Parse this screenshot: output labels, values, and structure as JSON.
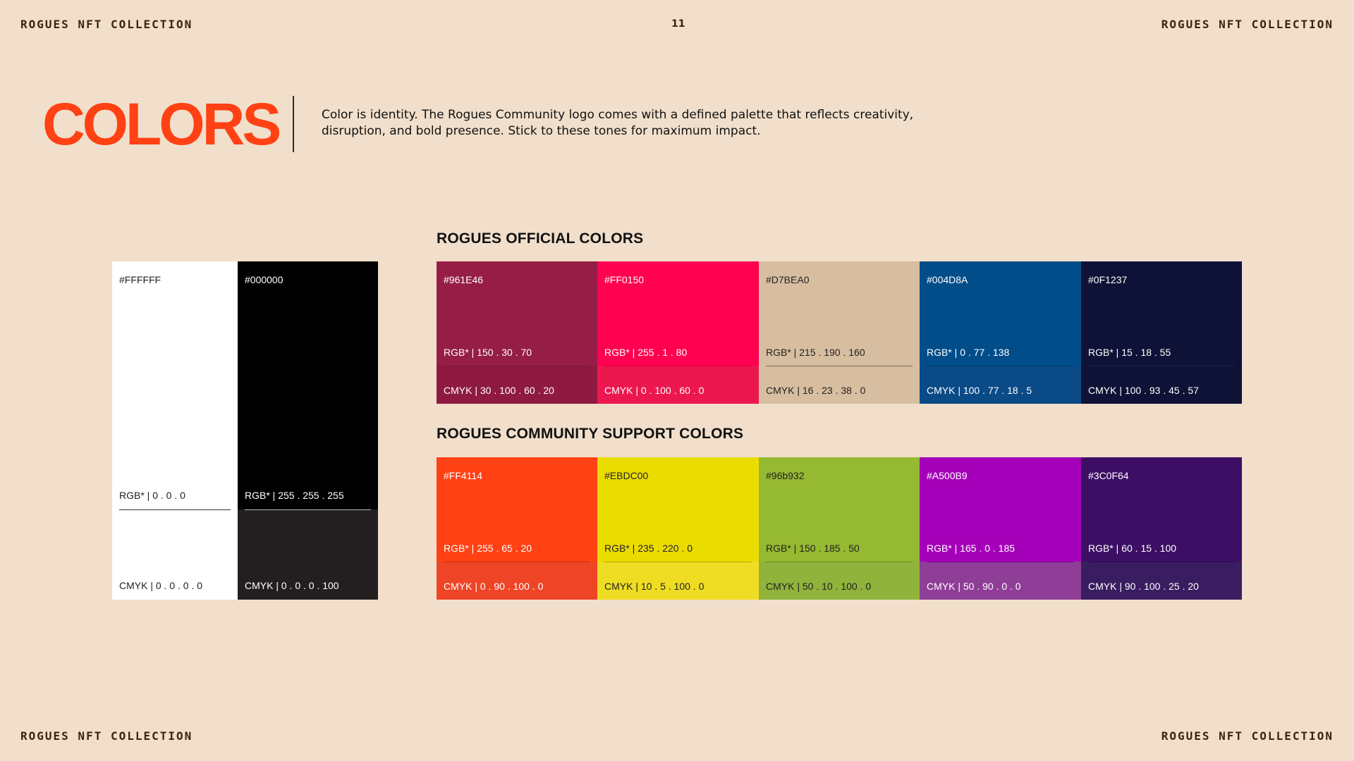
{
  "header": {
    "brand_left": "ROGUES NFT COLLECTION",
    "brand_right": "ROGUES NFT COLLECTION",
    "page_number": "11"
  },
  "footer": {
    "brand_left": "ROGUES NFT COLLECTION",
    "brand_right": "ROGUES NFT COLLECTION"
  },
  "title": "COLORS",
  "intro": "Color is identity. The Rogues Community logo comes with a defined palette that reflects creativity, disruption, and bold presence. Stick to these tones for maximum impact.",
  "base_colors": [
    {
      "hex": "#FFFFFF",
      "rgb": "RGB* | 0 . 0 . 0",
      "cmyk": "CMYK | 0 . 0 . 0 . 0",
      "color": "#FFFFFF",
      "lower_color": "#FFFFFF",
      "text_color": "#222222",
      "rule_color": "#333333"
    },
    {
      "hex": "#000000",
      "rgb": "RGB* | 255 . 255 . 255",
      "cmyk": "CMYK | 0 . 0 . 0 . 100",
      "color": "#000000",
      "lower_color": "#231F20",
      "text_color": "#FFFFFF",
      "rule_color": "#BBBBBB"
    }
  ],
  "official": {
    "heading": "ROGUES OFFICIAL COLORS",
    "colors": [
      {
        "hex": "#961E46",
        "rgb": "RGB* | 150 . 30 . 70",
        "cmyk": "CMYK | 30 . 100 . 60 . 20",
        "color": "#961E46",
        "lower_color": "#8E1A41",
        "text_color": "#FFFFFF",
        "rule_color": "#7A1538"
      },
      {
        "hex": "#FF0150",
        "rgb": "RGB* | 255 . 1 . 80",
        "cmyk": "CMYK | 0 . 100 . 60 . 0",
        "color": "#FF0150",
        "lower_color": "#ED174F",
        "text_color": "#FFFFFF",
        "rule_color": "#D8003F"
      },
      {
        "hex": "#D7BEA0",
        "rgb": "RGB* | 215 . 190 . 160",
        "cmyk": "CMYK | 16 . 23 . 38 . 0",
        "color": "#D7BEA0",
        "lower_color": "#D7BEA0",
        "text_color": "#222222",
        "rule_color": "#7A6A58"
      },
      {
        "hex": "#004D8A",
        "rgb": "RGB* | 0 . 77 . 138",
        "cmyk": "CMYK | 100 . 77 . 18 . 5",
        "color": "#004D8A",
        "lower_color": "#0A4A87",
        "text_color": "#FFFFFF",
        "rule_color": "#003E70"
      },
      {
        "hex": "#0F1237",
        "rgb": "RGB* | 15 . 18 . 55",
        "cmyk": "CMYK | 100 . 93 . 45 . 57",
        "color": "#0F1237",
        "lower_color": "#0E1236",
        "text_color": "#FFFFFF",
        "rule_color": "#1F2450"
      }
    ]
  },
  "support": {
    "heading": "ROGUES COMMUNITY SUPPORT COLORS",
    "colors": [
      {
        "hex": "#FF4114",
        "rgb": "RGB* | 255 . 65 . 20",
        "cmyk": "CMYK | 0 . 90 . 100 . 0",
        "color": "#FF4114",
        "lower_color": "#EE4526",
        "text_color": "#FFFFFF",
        "rule_color": "#C73008"
      },
      {
        "hex": "#EBDC00",
        "rgb": "RGB* | 235 . 220 . 0",
        "cmyk": "CMYK | 10 . 5 . 100 . 0",
        "color": "#EBDC00",
        "lower_color": "#EEDD22",
        "text_color": "#222222",
        "rule_color": "#B5A800"
      },
      {
        "hex": "#96b932",
        "rgb": "RGB* | 150 . 185 . 50",
        "cmyk": "CMYK | 50 . 10 . 100 . 0",
        "color": "#96B932",
        "lower_color": "#8FB33B",
        "text_color": "#222222",
        "rule_color": "#6E8A22"
      },
      {
        "hex": "#A500B9",
        "rgb": "RGB* | 165 . 0 . 185",
        "cmyk": "CMYK | 50 . 90 . 0 . 0",
        "color": "#A500B9",
        "lower_color": "#8F3E98",
        "text_color": "#FFFFFF",
        "rule_color": "#7E0090"
      },
      {
        "hex": "#3C0F64",
        "rgb": "RGB* | 60 . 15 . 100",
        "cmyk": "CMYK | 90 . 100 . 25 . 20",
        "color": "#3C0F64",
        "lower_color": "#3A1D60",
        "text_color": "#FFFFFF",
        "rule_color": "#2C0A4C"
      }
    ]
  }
}
